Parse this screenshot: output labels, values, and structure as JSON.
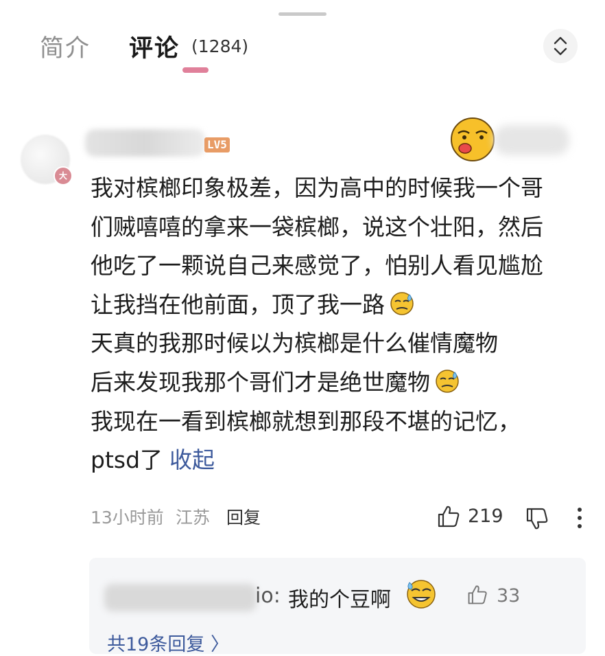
{
  "tabs": {
    "intro_label": "简介",
    "comments_label": "评论",
    "comments_count": "(1284)"
  },
  "comment": {
    "level_badge": "LV5",
    "avatar_badge": "大",
    "lines": [
      "我对槟榔印象极差，因为高中的时候我一个哥",
      "们贼嘻嘻的拿来一袋槟榔，说这个壮阳，然后",
      "他吃了一颗说自己来感觉了，怕别人看见尴尬",
      "让我挡在他前面，顶了我一路",
      "天真的我那时候以为槟榔是什么催情魔物",
      "后来发现我那个哥们才是绝世魔物",
      "我现在一看到槟榔就想到那段不堪的记忆，",
      "ptsd了"
    ],
    "collapse_label": "收起",
    "time": "13小时前",
    "location": "江苏",
    "reply_label": "回复",
    "like_count": "219"
  },
  "reply_preview": {
    "name_tail": "io:",
    "text": "我的个豆啊",
    "like_count": "33",
    "more_replies_label": "共19条回复 〉"
  },
  "icons": {
    "sort": "sort-updown-icon",
    "like": "thumbs-up-icon",
    "dislike": "thumbs-down-icon",
    "more": "more-vertical-icon",
    "emoji": "sweat-emoji-icon"
  },
  "colors": {
    "accent_underline": "#e0809a",
    "link": "#3d5a9c",
    "level_badge": "#e89c66"
  }
}
